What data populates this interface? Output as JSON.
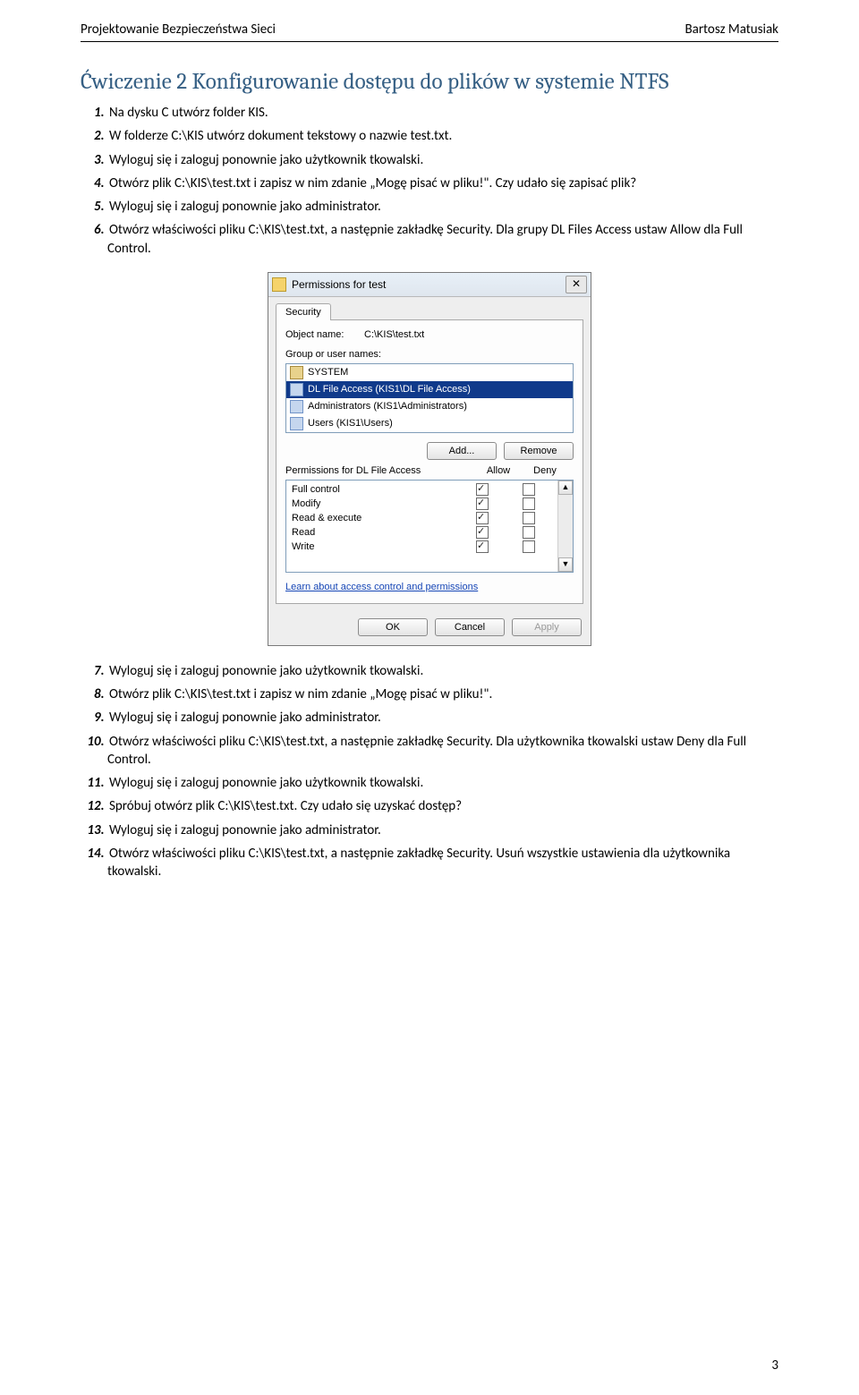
{
  "header": {
    "left": "Projektowanie Bezpieczeństwa Sieci",
    "right": "Bartosz Matusiak"
  },
  "exercise_title": "Ćwiczenie 2 Konfigurowanie dostępu do plików w systemie NTFS",
  "steps_top": [
    "Na dysku C utwórz folder KIS.",
    "W folderze C:\\KIS utwórz dokument tekstowy o nazwie test.txt.",
    "Wyloguj się i zaloguj ponownie jako użytkownik tkowalski.",
    "Otwórz plik C:\\KIS\\test.txt i zapisz w nim zdanie „Mogę pisać w pliku!\". Czy udało się zapisać plik?",
    "Wyloguj się i zaloguj ponownie jako administrator.",
    "Otwórz właściwości pliku C:\\KIS\\test.txt, a następnie zakładkę Security. Dla grupy DL Files Access ustaw Allow dla Full Control."
  ],
  "steps_bottom": [
    "Wyloguj się i zaloguj ponownie jako użytkownik tkowalski.",
    "Otwórz plik C:\\KIS\\test.txt i zapisz w nim zdanie „Mogę pisać w pliku!\".",
    "Wyloguj się i zaloguj ponownie jako administrator.",
    "Otwórz właściwości pliku C:\\KIS\\test.txt, a następnie zakładkę Security. Dla użytkownika tkowalski ustaw Deny dla Full Control.",
    "Wyloguj się i zaloguj ponownie jako użytkownik tkowalski.",
    "Spróbuj otwórz plik C:\\KIS\\test.txt. Czy udało się uzyskać dostęp?",
    "Wyloguj się i zaloguj ponownie jako administrator.",
    "Otwórz właściwości pliku C:\\KIS\\test.txt, a następnie zakładkę Security. Usuń wszystkie ustawienia dla użytkownika tkowalski."
  ],
  "dialog": {
    "title": "Permissions for test",
    "close_glyph": "✕",
    "tab": "Security",
    "object_label": "Object name:",
    "object_value": "C:\\KIS\\test.txt",
    "group_label": "Group or user names:",
    "principals": [
      "SYSTEM",
      "DL File Access (KIS1\\DL File Access)",
      "Administrators (KIS1\\Administrators)",
      "Users (KIS1\\Users)"
    ],
    "add_btn": "Add...",
    "remove_btn": "Remove",
    "perm_for_label": "Permissions for DL File Access",
    "allow_label": "Allow",
    "deny_label": "Deny",
    "perms": [
      {
        "name": "Full control",
        "allow": true,
        "deny": false
      },
      {
        "name": "Modify",
        "allow": true,
        "deny": false
      },
      {
        "name": "Read & execute",
        "allow": true,
        "deny": false
      },
      {
        "name": "Read",
        "allow": true,
        "deny": false
      },
      {
        "name": "Write",
        "allow": true,
        "deny": false
      }
    ],
    "scroll_up": "▲",
    "scroll_down": "▼",
    "learn_link": "Learn about access control and permissions",
    "ok_btn": "OK",
    "cancel_btn": "Cancel",
    "apply_btn": "Apply"
  },
  "page_number": "3"
}
